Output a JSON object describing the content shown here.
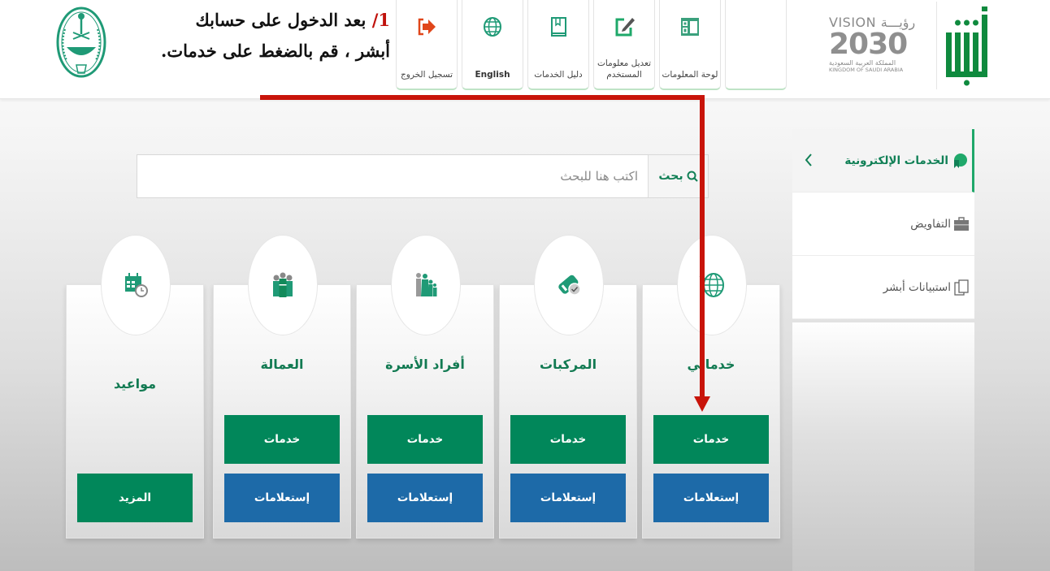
{
  "instruction": {
    "step": "1/",
    "line1": "بعد الدخول على حسابك",
    "line2": "أبشر ، قم بالضغط على خدمات."
  },
  "header": {
    "nav": [
      {
        "label": "تسجيل الخروج",
        "icon": "logout-icon",
        "color": "#e0461a"
      },
      {
        "label": "English",
        "icon": "globe-icon",
        "color": "#1f9a76"
      },
      {
        "label": "دليل الخدمات",
        "icon": "book-icon",
        "color": "#1f9a76"
      },
      {
        "label": "تعديل معلومات المستخدم",
        "icon": "edit-icon",
        "color": "#1f9a76"
      },
      {
        "label": "لوحة المعلومات",
        "icon": "dashboard-icon",
        "color": "#1f9a76"
      },
      {
        "label": "",
        "icon": "",
        "color": ""
      }
    ],
    "vision": {
      "top_en": "VISION",
      "top_ar": "رؤيـــة",
      "year": "2030",
      "kingdom_ar": "المملكة العربية السعودية",
      "kingdom_en": "KINGDOM OF SAUDI ARABIA"
    },
    "brand": "أبشر"
  },
  "sidebar": {
    "items": [
      {
        "label": "الخدمات الإلكترونية",
        "icon": "eservices-icon",
        "active": true
      },
      {
        "label": "التفاويض",
        "icon": "briefcase-icon",
        "active": false
      },
      {
        "label": "استبيانات أبشر",
        "icon": "documents-icon",
        "active": false
      }
    ]
  },
  "search": {
    "button_label": "بحث",
    "placeholder": "اكتب هنا للبحث",
    "value": ""
  },
  "cards": [
    {
      "title": "خدماتي",
      "icon": "globe-icon",
      "buttons": [
        "خدمات",
        "إستعلامات"
      ]
    },
    {
      "title": "المركبات",
      "icon": "vehicle-icon",
      "buttons": [
        "خدمات",
        "إستعلامات"
      ]
    },
    {
      "title": "أفراد الأسرة",
      "icon": "family-icon",
      "buttons": [
        "خدمات",
        "إستعلامات"
      ]
    },
    {
      "title": "العمالة",
      "icon": "workers-icon",
      "buttons": [
        "خدمات",
        "إستعلامات"
      ]
    },
    {
      "title": "مواعيد",
      "icon": "calendar-icon",
      "buttons": [
        "المزيد"
      ]
    }
  ],
  "colors": {
    "primary_green": "#01875a",
    "inquiry_blue": "#1d6aa8",
    "annotation_red": "#c8140a",
    "title_green": "#127a52"
  }
}
